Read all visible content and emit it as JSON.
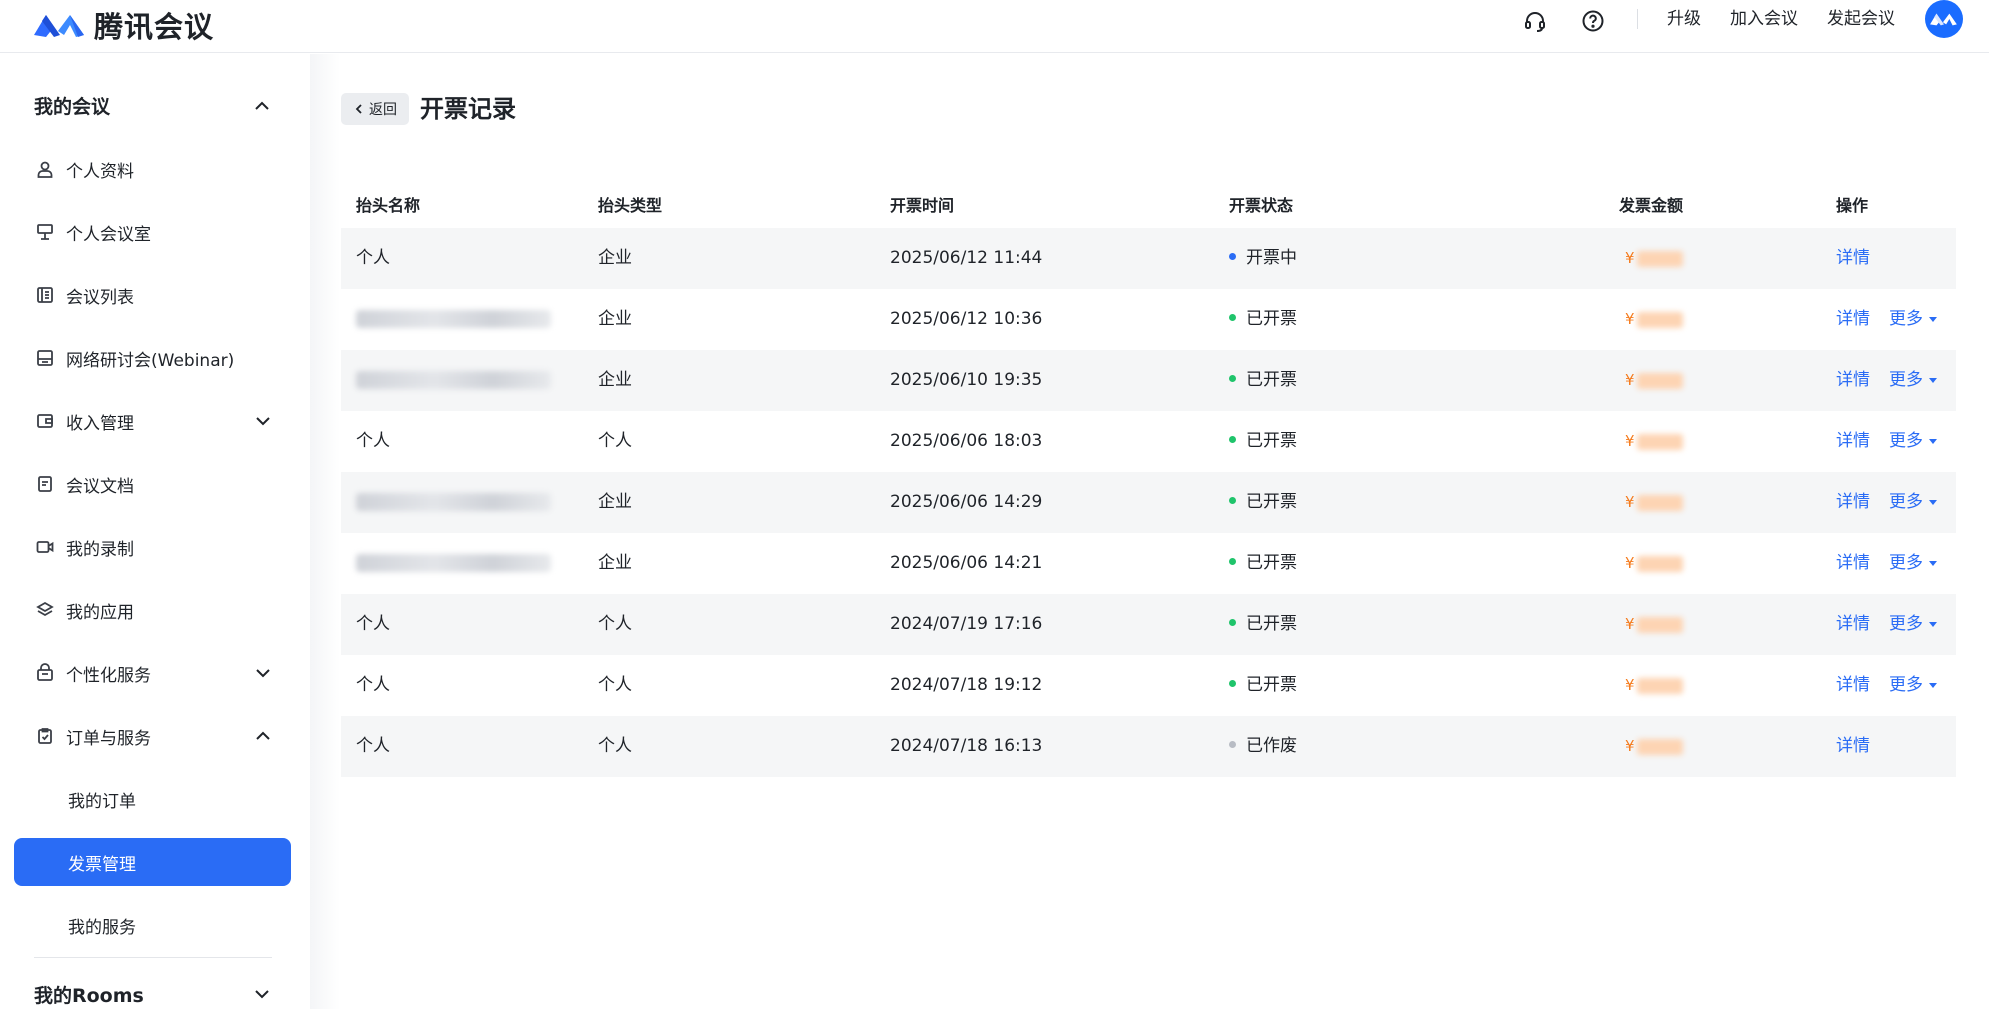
{
  "colors": {
    "accent": "#2a6cf5",
    "status_processing": "#2a6cf5",
    "status_done": "#1fc46b",
    "status_void": "#b8bcc4",
    "amount": "#f57a1b"
  },
  "header": {
    "app_name": "腾讯会议",
    "support_icon": "headset-icon",
    "help_icon": "help-circle-icon",
    "upgrade_label": "升级",
    "join_label": "加入会议",
    "start_label": "发起会议"
  },
  "sidebar": {
    "group_my_meetings": "我的会议",
    "items": [
      {
        "label": "个人资料",
        "icon": "user-icon"
      },
      {
        "label": "个人会议室",
        "icon": "podium-icon"
      },
      {
        "label": "会议列表",
        "icon": "list-icon"
      },
      {
        "label": "网络研讨会(Webinar)",
        "icon": "webinar-icon"
      },
      {
        "label": "收入管理",
        "icon": "wallet-icon"
      },
      {
        "label": "会议文档",
        "icon": "document-icon"
      },
      {
        "label": "我的录制",
        "icon": "video-icon"
      },
      {
        "label": "我的应用",
        "icon": "layers-icon"
      },
      {
        "label": "个性化服务",
        "icon": "service-icon"
      },
      {
        "label": "订单与服务",
        "icon": "clipboard-icon"
      }
    ],
    "sub_items": [
      {
        "label": "我的订单"
      },
      {
        "label": "发票管理"
      },
      {
        "label": "我的服务"
      }
    ],
    "group_rooms": "我的Rooms"
  },
  "page": {
    "back_label": "返回",
    "title": "开票记录"
  },
  "table": {
    "columns": [
      "抬头名称",
      "抬头类型",
      "开票时间",
      "开票状态",
      "发票金额",
      "操作"
    ],
    "rows": [
      {
        "name": "个人",
        "name_blurred": false,
        "type": "企业",
        "time": "2025/06/12 11:44",
        "status": "开票中",
        "status_kind": "processing",
        "currency": "¥",
        "detail": "详情",
        "more": ""
      },
      {
        "name": "",
        "name_blurred": true,
        "type": "企业",
        "time": "2025/06/12 10:36",
        "status": "已开票",
        "status_kind": "done",
        "currency": "¥",
        "detail": "详情",
        "more": "更多"
      },
      {
        "name": "",
        "name_blurred": true,
        "type": "企业",
        "time": "2025/06/10 19:35",
        "status": "已开票",
        "status_kind": "done",
        "currency": "¥",
        "detail": "详情",
        "more": "更多"
      },
      {
        "name": "个人",
        "name_blurred": false,
        "type": "个人",
        "time": "2025/06/06 18:03",
        "status": "已开票",
        "status_kind": "done",
        "currency": "¥",
        "detail": "详情",
        "more": "更多"
      },
      {
        "name": "",
        "name_blurred": true,
        "type": "企业",
        "time": "2025/06/06 14:29",
        "status": "已开票",
        "status_kind": "done",
        "currency": "¥",
        "detail": "详情",
        "more": "更多"
      },
      {
        "name": "",
        "name_blurred": true,
        "type": "企业",
        "time": "2025/06/06 14:21",
        "status": "已开票",
        "status_kind": "done",
        "currency": "¥",
        "detail": "详情",
        "more": "更多"
      },
      {
        "name": "个人",
        "name_blurred": false,
        "type": "个人",
        "time": "2024/07/19 17:16",
        "status": "已开票",
        "status_kind": "done",
        "currency": "¥",
        "detail": "详情",
        "more": "更多"
      },
      {
        "name": "个人",
        "name_blurred": false,
        "type": "个人",
        "time": "2024/07/18 19:12",
        "status": "已开票",
        "status_kind": "done",
        "currency": "¥",
        "detail": "详情",
        "more": "更多"
      },
      {
        "name": "个人",
        "name_blurred": false,
        "type": "个人",
        "time": "2024/07/18 16:13",
        "status": "已作废",
        "status_kind": "void",
        "currency": "¥",
        "detail": "详情",
        "more": ""
      }
    ]
  }
}
